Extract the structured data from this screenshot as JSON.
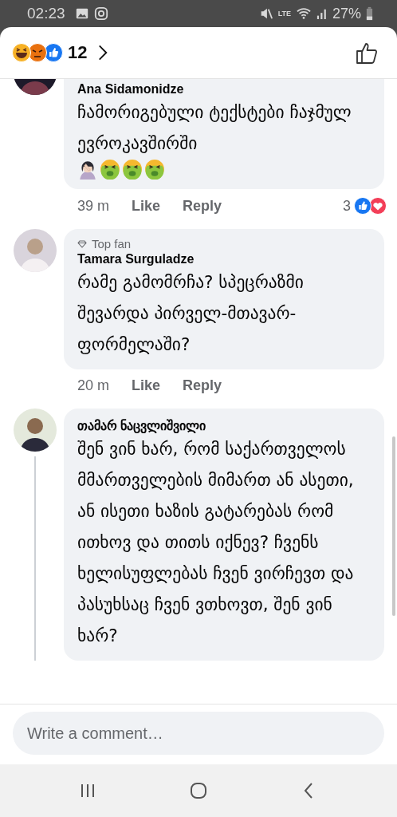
{
  "status_bar": {
    "time": "02:23",
    "network": "LTE",
    "battery": "27%"
  },
  "header": {
    "reactions": [
      {
        "kind": "haha"
      },
      {
        "kind": "angry"
      },
      {
        "kind": "like"
      }
    ],
    "reaction_count": "12"
  },
  "comments": [
    {
      "author": "Ana Sidamonidze",
      "text": "ჩამორიგებული ტექსტები ჩაჯმულ ევროკავშირში",
      "emojis": [
        {
          "kind": "facepalm"
        },
        {
          "kind": "vomit"
        },
        {
          "kind": "vomit"
        },
        {
          "kind": "vomit"
        }
      ],
      "time": "39 m",
      "actions": [
        "Like",
        "Reply"
      ],
      "reactions": {
        "count": "3",
        "kinds": [
          {
            "kind": "like"
          },
          {
            "kind": "love"
          }
        ]
      },
      "thread": false
    },
    {
      "author": "Tamara Surguladze",
      "badge": "Top fan",
      "text": "რამე გამომრჩა? სპეცრაზმი შევარდა პირველ-მთავარ-ფორმელაში?",
      "time": "20 m",
      "actions": [
        "Like",
        "Reply"
      ],
      "thread": false
    },
    {
      "author": "თამარ ნაცვლიშვილი",
      "text": "შენ ვინ ხარ, რომ საქართველოს მმართველების მიმართ ან ასეთი, ან ისეთი ხაზის გატარებას რომ ითხოვ და თითს იქნევ? ჩვენს ხელისუფლებას ჩვენ ვირჩევთ და პასუხსაც ჩვენ ვთხოვთ, შენ ვინ ხარ?",
      "thread": true
    }
  ],
  "composer": {
    "placeholder": "Write a comment…"
  }
}
